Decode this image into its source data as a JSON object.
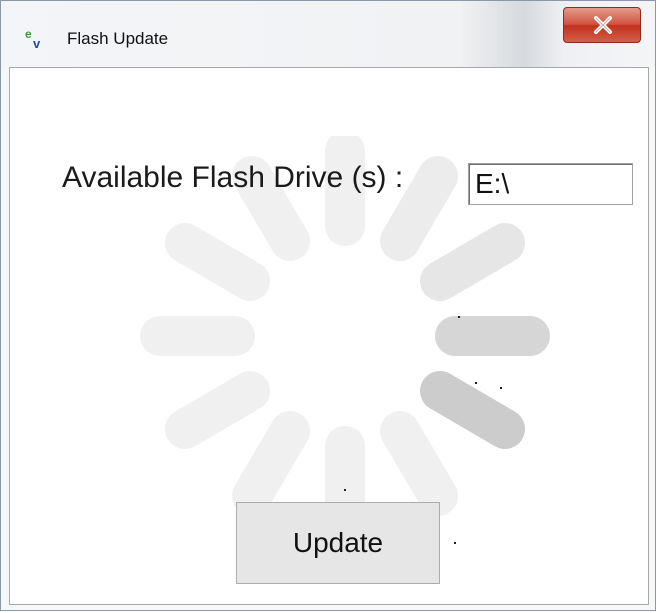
{
  "window": {
    "title": "Flash Update",
    "icon": "ev-app-icon",
    "close_icon": "close-icon"
  },
  "form": {
    "drive_label": "Available Flash Drive (s) :",
    "drive_value": "E:\\",
    "update_label": "Update"
  },
  "spinner": {
    "icon": "loading-spinner-icon",
    "highlight_color": "#cccccc",
    "dim_color": "#efefef"
  },
  "colors": {
    "close_button": "#c73a23",
    "window_border": "#8a98a8",
    "button_face": "#e6e6e6"
  }
}
